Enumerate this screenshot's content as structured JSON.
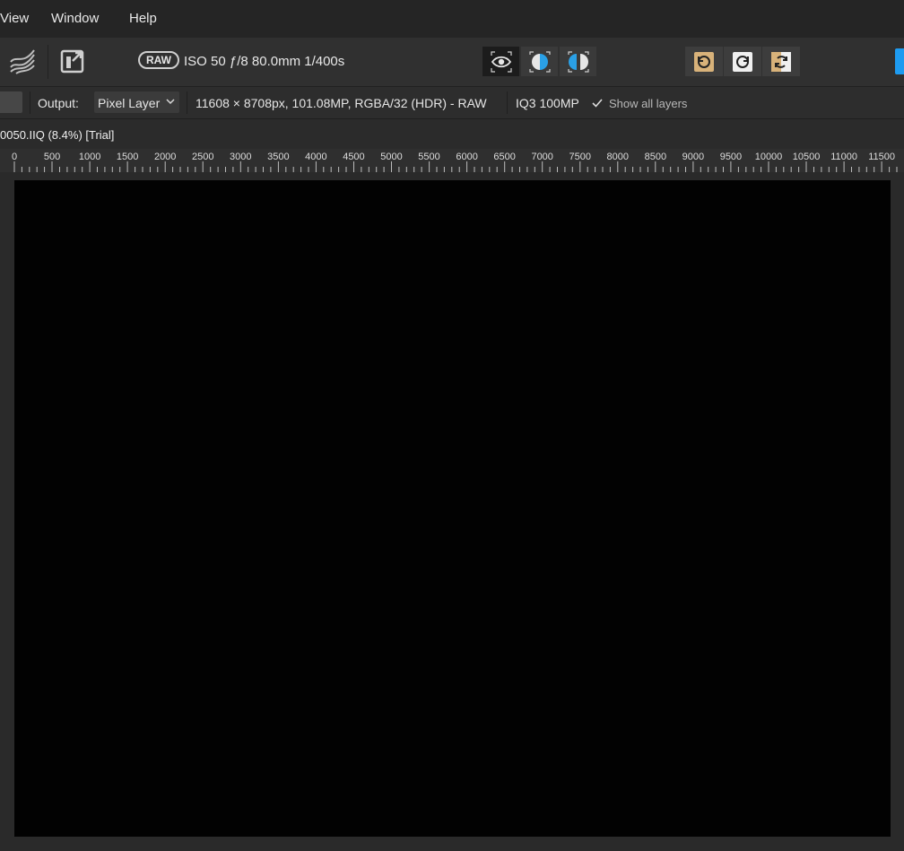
{
  "menu": {
    "items": [
      "View",
      "Window",
      "Help"
    ]
  },
  "toolbar": {
    "raw_badge": "RAW",
    "exif": "ISO 50 ƒ/8 80.0mm 1/400s",
    "view_modes": [
      {
        "icon": "eye-icon",
        "active": true
      },
      {
        "icon": "split-view-icon",
        "active": false
      },
      {
        "icon": "mirrored-split-view-icon",
        "active": false
      }
    ],
    "rotate_buttons": [
      {
        "icon": "rotate-left-icon"
      },
      {
        "icon": "rotate-right-icon"
      },
      {
        "icon": "flip-vertical-icon"
      }
    ],
    "accent_color": "#1e9bf0"
  },
  "context_bar": {
    "output_label": "Output:",
    "output_value": "Pixel Layer",
    "image_info": "11608 × 8708px, 101.08MP, RGBA/32 (HDR) - RAW",
    "camera": "IQ3 100MP",
    "show_all_layers": {
      "label": "Show all layers",
      "checked": true
    }
  },
  "document": {
    "tab_title": "0050.IIQ (8.4%) [Trial]"
  },
  "ruler": {
    "labels": [
      "0",
      "500",
      "1000",
      "1500",
      "2000",
      "2500",
      "3000",
      "3500",
      "4000",
      "4500",
      "5000",
      "5500",
      "6000",
      "6500",
      "7000",
      "7500",
      "8000",
      "8500",
      "9000",
      "9500",
      "10000",
      "10500",
      "11000",
      "11500"
    ]
  }
}
